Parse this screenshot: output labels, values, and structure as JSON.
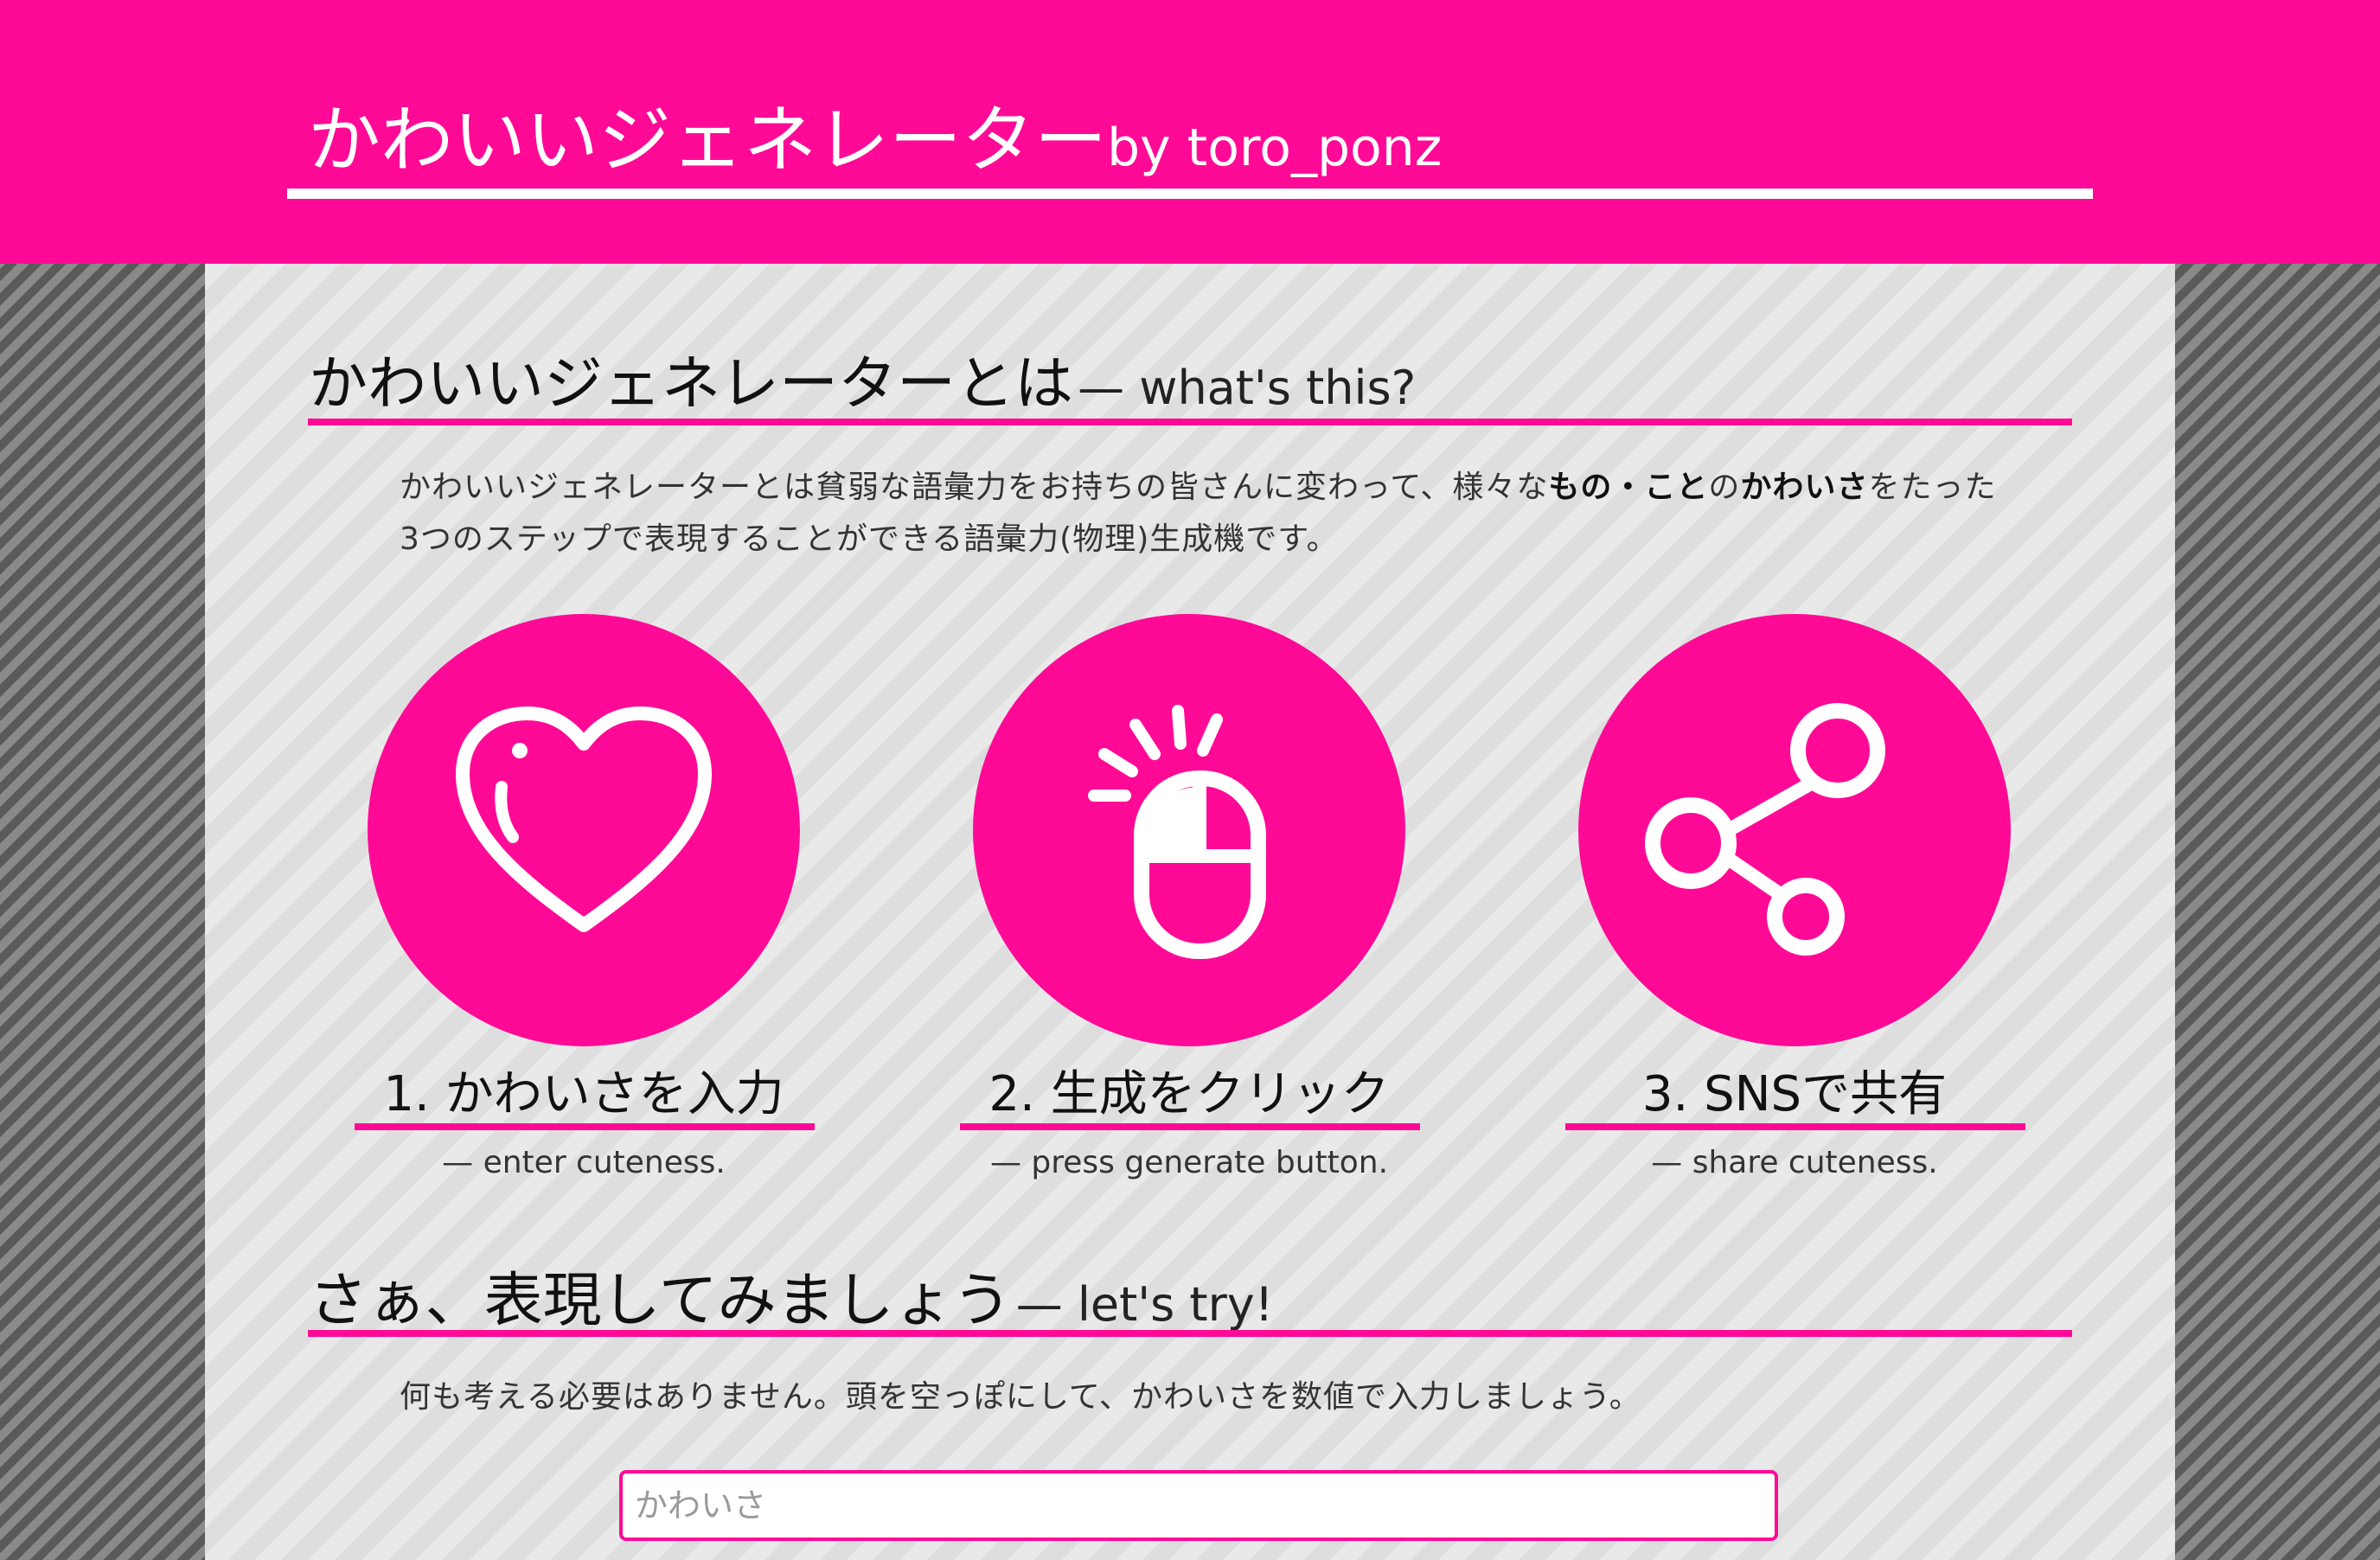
{
  "header": {
    "title": "かわいいジェネレーター",
    "byline": "by toro_ponz"
  },
  "about": {
    "heading": "かわいいジェネレーターとは",
    "heading_en": "— what's this?",
    "desc_part1": "かわいいジェネレーターとは貧弱な語彙力をお持ちの皆さんに変わって、様々な",
    "desc_bold1": "もの・こと",
    "desc_part2": "の",
    "desc_bold2": "かわいさ",
    "desc_part3": "をたった3つのステップで表現することができる語彙力(物理)生成機です。"
  },
  "steps": [
    {
      "label": "1. かわいさを入力",
      "sub": "— enter cuteness.",
      "icon": "heart-icon"
    },
    {
      "label": "2. 生成をクリック",
      "sub": "— press generate button.",
      "icon": "mouse-click-icon"
    },
    {
      "label": "3. SNSで共有",
      "sub": "— share cuteness.",
      "icon": "share-icon"
    }
  ],
  "try": {
    "heading": "さぁ、表現してみましょう",
    "heading_en": "— let's try!",
    "desc": "何も考える必要はありません。頭を空っぽにして、かわいさを数値で入力しましょう。",
    "input_placeholder": "かわいさ",
    "input_value": ""
  },
  "colors": {
    "accent": "#ff0a96",
    "background_stripe_dark": "#5a5a5a",
    "background_stripe_light": "#8a8a8a"
  }
}
